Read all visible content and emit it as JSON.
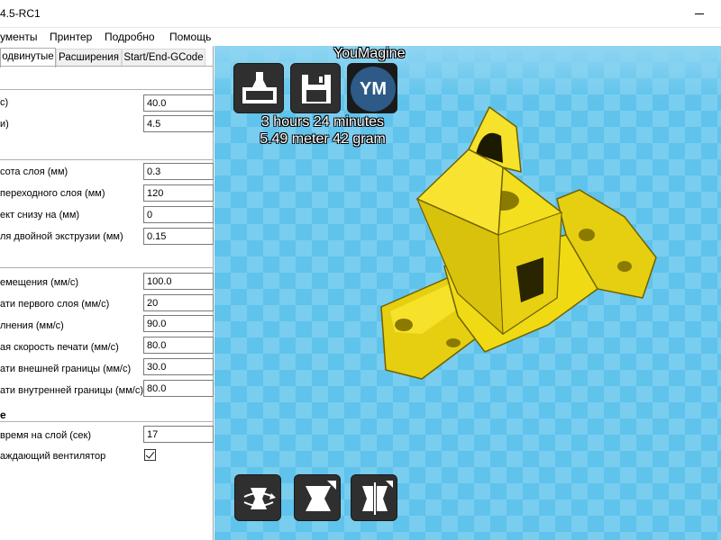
{
  "window": {
    "title": "4.5-RC1"
  },
  "menu": [
    "ументы",
    "Принтер",
    "Подробно",
    "Помощь"
  ],
  "tabs": [
    "одвинутые",
    "Расширения",
    "Start/End-GCode"
  ],
  "sections": {
    "retraction": {
      "rows": [
        {
          "label": "c)",
          "value": "40.0"
        },
        {
          "label": "и)",
          "value": "4.5"
        }
      ]
    },
    "quality": {
      "rows": [
        {
          "label": "сота слоя (мм)",
          "value": "0.3"
        },
        {
          "label": " переходного слоя (мм)",
          "value": "120"
        },
        {
          "label": "ект снизу на (мм)",
          "value": "0"
        },
        {
          "label": "ля двойной экструзии (мм)",
          "value": "0.15"
        }
      ]
    },
    "speed": {
      "rows": [
        {
          "label": "емещения (мм/с)",
          "value": "100.0"
        },
        {
          "label": "ати первого слоя (мм/с)",
          "value": "20"
        },
        {
          "label": "лнения (мм/с)",
          "value": "90.0"
        },
        {
          "label": "ая скорость печати (мм/с)",
          "value": "80.0"
        },
        {
          "label": "ати внешней границы (мм/с)",
          "value": "30.0"
        },
        {
          "label": "ати внутренней границы (мм/с)",
          "value": "80.0"
        }
      ]
    },
    "cooling": {
      "title": "е",
      "time_label": "время на слой (сек)",
      "time_value": "17",
      "fan_label": "аждающий вентилятор",
      "fan_checked": true
    }
  },
  "viewport": {
    "youmagine": "YouMagine",
    "ym_label": "YM",
    "print_time": "3 hours 24 minutes",
    "print_material": "5.49 meter 42 gram",
    "colors": {
      "background": "#5fc3ec",
      "model": "#f2dc14",
      "model_shadow": "#8a7a00"
    },
    "icons": [
      "load-model-icon",
      "save-gcode-icon",
      "youmagine-icon",
      "rotate-icon",
      "scale-icon",
      "mirror-icon"
    ]
  }
}
